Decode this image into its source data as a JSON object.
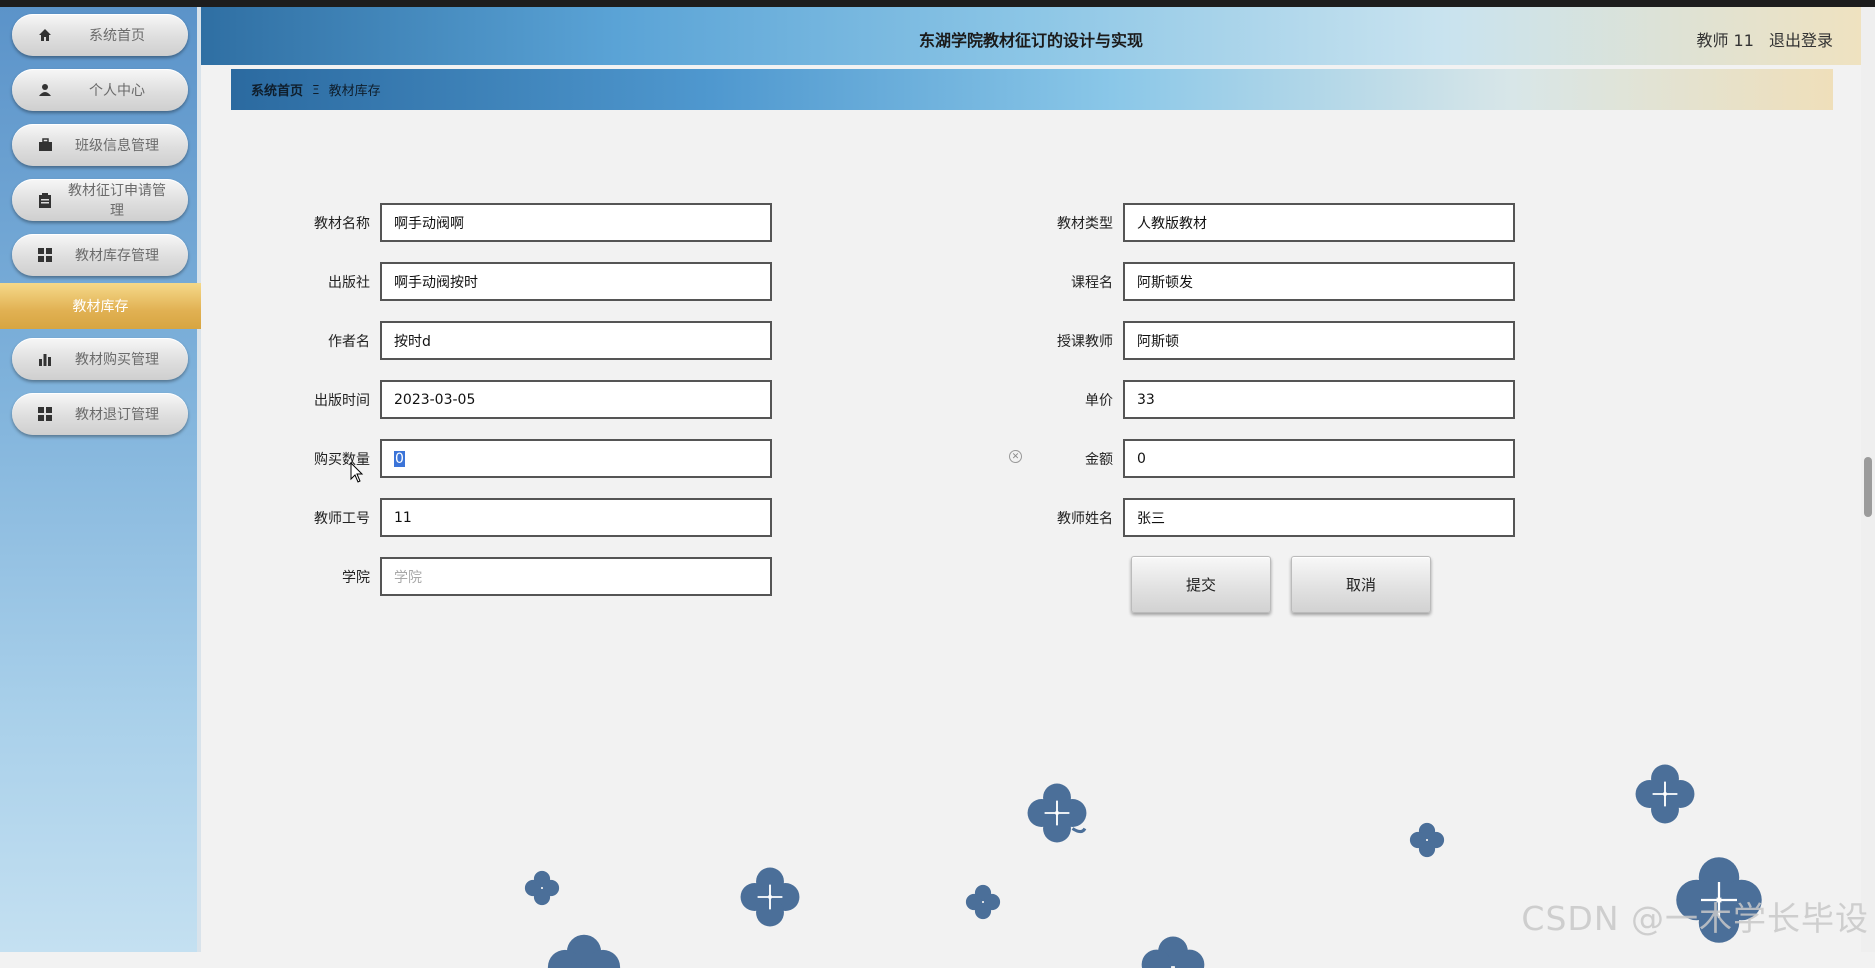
{
  "header": {
    "title": "东湖学院教材征订的设计与实现",
    "user": "教师 11",
    "logout": "退出登录"
  },
  "sidebar": {
    "items": [
      {
        "label": "系统首页",
        "icon": "home-icon"
      },
      {
        "label": "个人中心",
        "icon": "user-icon"
      },
      {
        "label": "班级信息管理",
        "icon": "briefcase-icon"
      },
      {
        "label": "教材征订申请管理",
        "icon": "clipboard-icon"
      },
      {
        "label": "教材库存管理",
        "icon": "grid-icon"
      },
      {
        "label": "教材购买管理",
        "icon": "bar-chart-icon"
      },
      {
        "label": "教材退订管理",
        "icon": "grid-icon"
      }
    ],
    "active_sub": "教材库存"
  },
  "breadcrumb": {
    "home": "系统首页",
    "separator": "Ξ",
    "current": "教材库存"
  },
  "form": {
    "left": [
      {
        "label": "教材名称",
        "value": "啊手动阀啊"
      },
      {
        "label": "出版社",
        "value": "啊手动阀按时"
      },
      {
        "label": "作者名",
        "value": "按时d"
      },
      {
        "label": "出版时间",
        "value": "2023-03-05"
      },
      {
        "label": "购买数量",
        "value": "0"
      },
      {
        "label": "教师工号",
        "value": "11"
      },
      {
        "label": "学院",
        "value": "",
        "placeholder": "学院"
      }
    ],
    "right": [
      {
        "label": "教材类型",
        "value": "人教版教材"
      },
      {
        "label": "课程名",
        "value": "阿斯顿发"
      },
      {
        "label": "授课教师",
        "value": "阿斯顿"
      },
      {
        "label": "单价",
        "value": "33"
      },
      {
        "label": "金额",
        "value": "0"
      },
      {
        "label": "教师姓名",
        "value": "张三"
      }
    ]
  },
  "buttons": {
    "submit": "提交",
    "cancel": "取消"
  },
  "watermark": "CSDN @一木学长毕设",
  "colors": {
    "flower": "#4b6f99",
    "active_nav": "#e1b153"
  }
}
